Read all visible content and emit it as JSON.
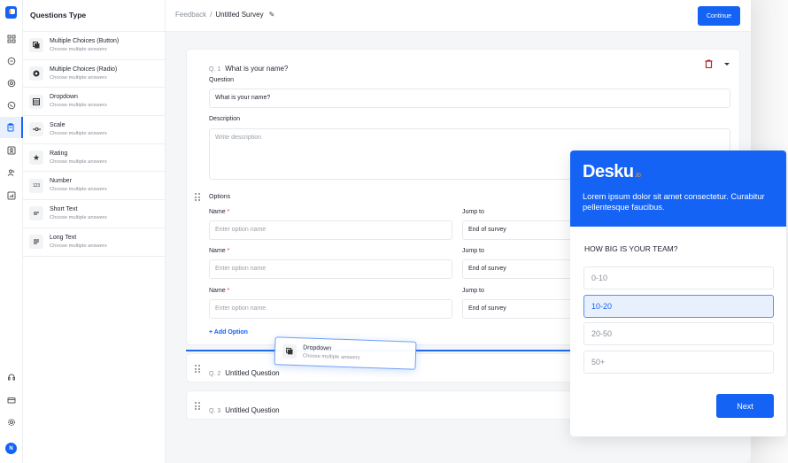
{
  "app": {
    "brand_accent": "#1463f5"
  },
  "rail": {
    "items": [
      {
        "name": "dashboard"
      },
      {
        "name": "chat"
      },
      {
        "name": "integrations"
      },
      {
        "name": "whatsapp"
      },
      {
        "name": "surveys",
        "active": true
      },
      {
        "name": "contacts"
      },
      {
        "name": "team"
      },
      {
        "name": "reports"
      }
    ],
    "bottom": [
      {
        "name": "support"
      },
      {
        "name": "billing"
      },
      {
        "name": "settings"
      }
    ],
    "avatar_initial": "N"
  },
  "types_panel": {
    "title": "Questions Type",
    "items": [
      {
        "title": "Multiple Choices (Button)",
        "subtitle": "Choose multiple answers",
        "icon": "checkbox-stack"
      },
      {
        "title": "Multiple Choices (Radio)",
        "subtitle": "Choose multiple answers",
        "icon": "radio"
      },
      {
        "title": "Dropdown",
        "subtitle": "Choose multiple answers",
        "icon": "dropdown-list"
      },
      {
        "title": "Scale",
        "subtitle": "Choose multiple answers",
        "icon": "scale-slider"
      },
      {
        "title": "Rating",
        "subtitle": "Choose multiple answers",
        "icon": "star"
      },
      {
        "title": "Number",
        "subtitle": "Choose multiple answers",
        "icon": "123"
      },
      {
        "title": "Short Text",
        "subtitle": "Choose multiple answers",
        "icon": "short-lines"
      },
      {
        "title": "Long Text",
        "subtitle": "Choose multiple answers",
        "icon": "long-lines"
      }
    ]
  },
  "topbar": {
    "breadcrumb_parent": "Feedback",
    "breadcrumb_sep": "/",
    "breadcrumb_current": "Untitled Survey",
    "continue_label": "Continue"
  },
  "question1": {
    "number": "Q. 1",
    "title": "What is your name?",
    "question_label": "Question",
    "question_value": "What is your name?",
    "description_label": "Description",
    "description_placeholder": "Write description",
    "options_label": "Options",
    "name_label": "Name",
    "required_mark": "*",
    "jump_label": "Jump to",
    "options": [
      {
        "placeholder": "Enter option name",
        "jump": "End of survey"
      },
      {
        "placeholder": "Enter option name",
        "jump": "End of survey"
      },
      {
        "placeholder": "Enter option name",
        "jump": "End of survey"
      }
    ],
    "add_option_label": "+ Add Option"
  },
  "question2": {
    "number": "Q. 2",
    "title": "Untitled Question"
  },
  "question3": {
    "number": "Q. 3",
    "title": "Untitled Question"
  },
  "drag_ghost": {
    "title": "Dropdown",
    "subtitle": "Choose multiple answers"
  },
  "preview": {
    "brand": "Desku",
    "brand_suffix": ".io",
    "description": "Lorem ipsum dolor sit amet consectetur. Curabitur pellentesque faucibus.",
    "question": "HOW BIG IS YOUR TEAM?",
    "options": [
      "0-10",
      "10-20",
      "20-50",
      "50+"
    ],
    "selected_index": 1,
    "next_label": "Next"
  }
}
